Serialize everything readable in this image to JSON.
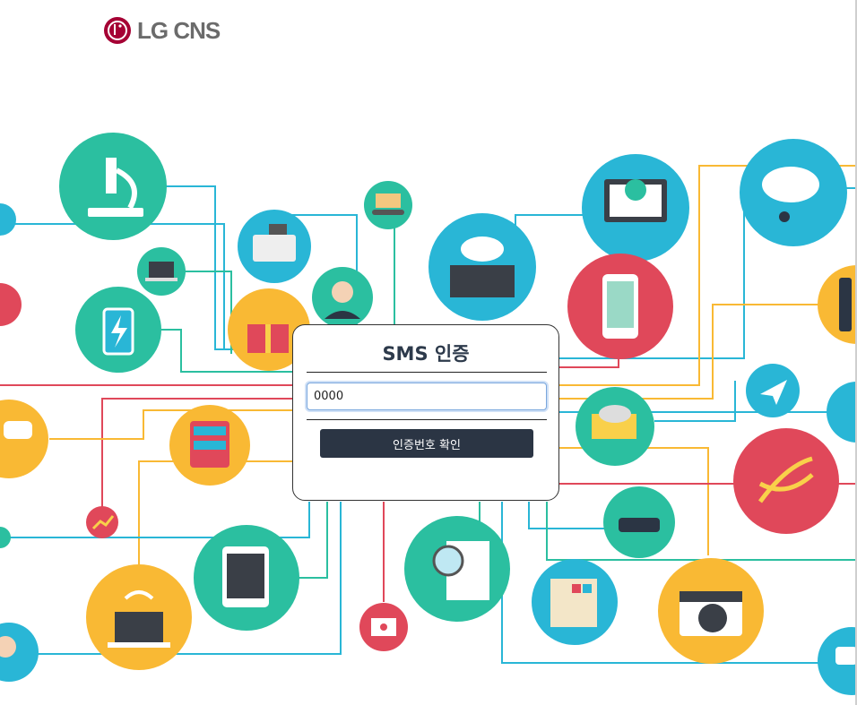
{
  "brand": {
    "name": "LG CNS",
    "logo_icon": "lg-logo-icon",
    "logo_color": "#a50034"
  },
  "sms_dialog": {
    "title": "SMS 인증",
    "code_input": {
      "value": "0000"
    },
    "confirm_button_label": "인증번호 확인"
  },
  "palette": {
    "teal": "#2bbfa0",
    "sky": "#29b6d6",
    "red": "#e0485a",
    "yellow": "#f9b934",
    "dark": "#2b3544"
  },
  "background_icons": [
    "microscope-icon",
    "conveyor-box-icon",
    "cash-register-icon",
    "laptop-cart-icon",
    "battery-icon",
    "shopping-bag-icon",
    "woman-avatar-icon",
    "cloud-server-icon",
    "monitor-download-icon",
    "phone-map-icon",
    "cloud-music-icon",
    "slider-icon",
    "chat-bubble-icon",
    "double-decker-bus-icon",
    "growth-chart-icon",
    "tablet-chart-icon",
    "wifi-laptop-icon",
    "man-avatar-icon",
    "mail-heart-icon",
    "report-search-icon",
    "color-palette-icon",
    "camera-icon",
    "car-icon",
    "truck-icon",
    "paper-plane-icon",
    "dna-icon",
    "speech-dots-icon"
  ]
}
